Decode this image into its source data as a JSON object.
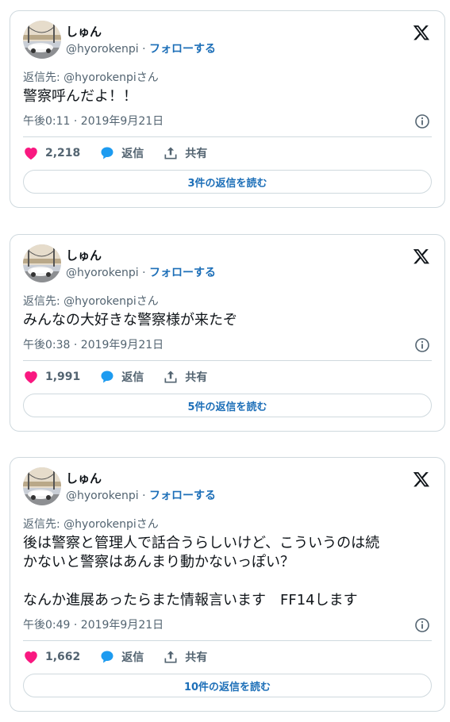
{
  "tweets": [
    {
      "name": "しゅん",
      "handle": "@hyorokenpi",
      "separator": "·",
      "follow_label": "フォローする",
      "reply_to": "返信先: @hyorokenpiさん",
      "text": "警察呼んだよ！！",
      "time": "午後0:11 · 2019年9月21日",
      "likes": "2,218",
      "reply_label": "返信",
      "share_label": "共有",
      "replies_button": "3件の返信を読む"
    },
    {
      "name": "しゅん",
      "handle": "@hyorokenpi",
      "separator": "·",
      "follow_label": "フォローする",
      "reply_to": "返信先: @hyorokenpiさん",
      "text": "みんなの大好きな警察様が来たぞ",
      "time": "午後0:38 · 2019年9月21日",
      "likes": "1,991",
      "reply_label": "返信",
      "share_label": "共有",
      "replies_button": "5件の返信を読む"
    },
    {
      "name": "しゅん",
      "handle": "@hyorokenpi",
      "separator": "·",
      "follow_label": "フォローする",
      "reply_to": "返信先: @hyorokenpiさん",
      "text": "後は警察と管理人で話合うらしいけど、こういうのは続\nかないと警察はあんまり動かないっぽい？\n\nなんか進展あったらまた情報言います　FF14します",
      "time": "午後0:49 · 2019年9月21日",
      "likes": "1,662",
      "reply_label": "返信",
      "share_label": "共有",
      "replies_button": "10件の返信を読む"
    }
  ],
  "colors": {
    "like": "#f91880",
    "reply_bubble": "#1d9bf0",
    "link": "#1d6fb8",
    "muted": "#536471",
    "border": "#cfd9de"
  },
  "icons": [
    "x-logo-icon",
    "info-icon",
    "heart-icon",
    "reply-bubble-icon",
    "share-icon"
  ]
}
